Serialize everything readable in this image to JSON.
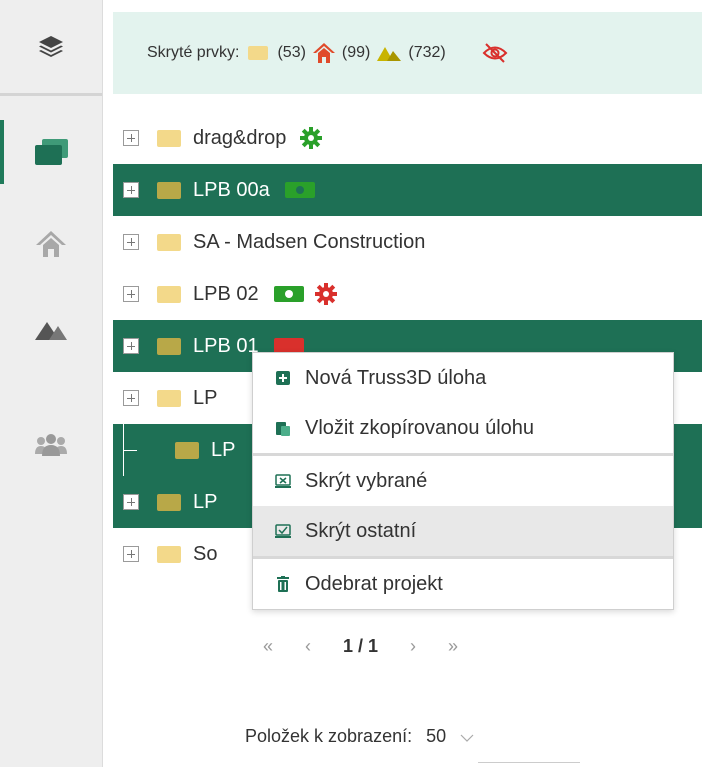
{
  "sidebar": {
    "items": [
      {
        "icon": "layers-icon"
      },
      {
        "icon": "folders-icon",
        "active": true
      },
      {
        "icon": "home-icon"
      },
      {
        "icon": "mountain-icon"
      },
      {
        "icon": "users-icon"
      }
    ]
  },
  "topbar": {
    "hidden_label": "Skryté prvky:",
    "folders_count": "(53)",
    "houses_count": "(99)",
    "mountains_count": "(732)"
  },
  "tree": {
    "rows": [
      {
        "label": "drag&drop"
      },
      {
        "label": "LPB 00a"
      },
      {
        "label": "SA - Madsen Construction"
      },
      {
        "label": "LPB 02"
      },
      {
        "label": "LPB 01"
      },
      {
        "label": "LP"
      },
      {
        "label": "LP"
      },
      {
        "label": "LP"
      },
      {
        "label": "So"
      }
    ]
  },
  "context_menu": {
    "items": [
      {
        "label": "Nová Truss3D úloha",
        "icon": "add-icon"
      },
      {
        "label": "Vložit zkopírovanou úlohu",
        "icon": "paste-icon"
      },
      {
        "label": "Skrýt vybrané",
        "icon": "hide-selected-icon"
      },
      {
        "label": "Skrýt ostatní",
        "icon": "hide-others-icon"
      },
      {
        "label": "Odebrat projekt",
        "icon": "trash-icon"
      }
    ]
  },
  "pager": {
    "first": "«",
    "prev": "‹",
    "page": "1 / 1",
    "next": "›",
    "last": "»"
  },
  "per_page": {
    "label": "Položek k zobrazení:",
    "value": "50"
  },
  "colors": {
    "accent": "#1e7055",
    "topbar_bg": "#e3f3ee",
    "folder": "#f3d98a",
    "gear_green": "#2aa02a",
    "gear_red": "#d9302c",
    "house_red": "#e04a2a",
    "mountain_yellow": "#c8b400"
  }
}
